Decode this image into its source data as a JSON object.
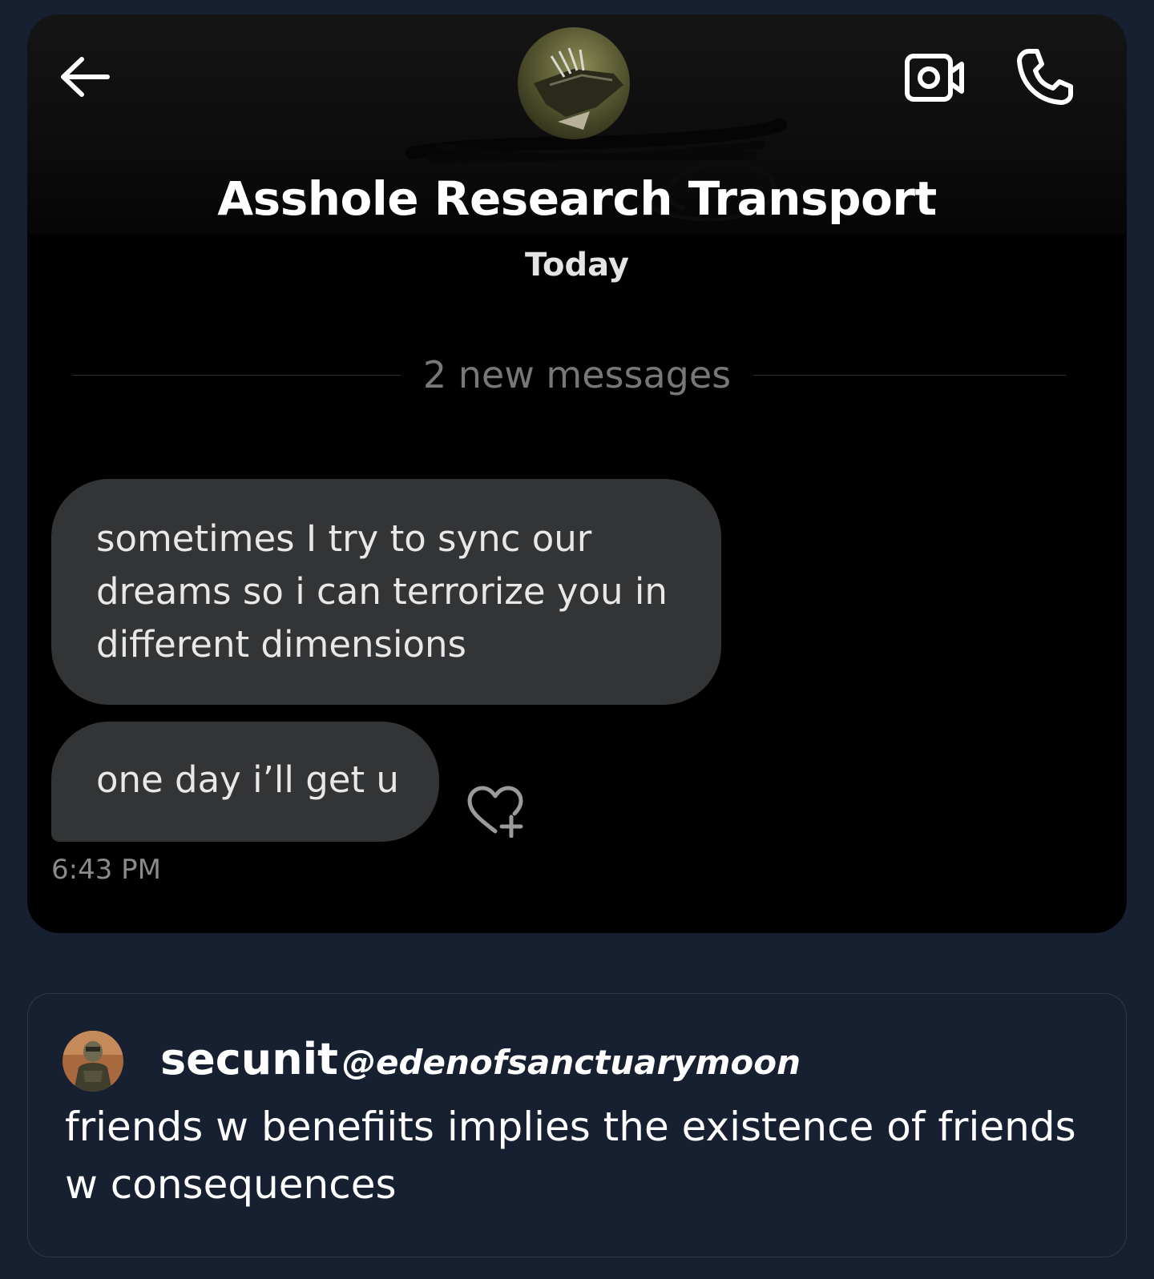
{
  "dm": {
    "contact_name": "Asshole Research Transport",
    "date_label": "Today",
    "new_messages_label": "2 new messages",
    "messages": [
      {
        "text": "sometimes I try to sync our dreams so i can terrorize you in different dimensions"
      },
      {
        "text": "one day i’ll get u"
      }
    ],
    "timestamp": "6:43 PM",
    "icons": {
      "back": "arrow-left-icon",
      "video": "video-camera-icon",
      "call": "phone-icon",
      "react": "heart-add-icon"
    }
  },
  "tweet": {
    "display_name": "secunit",
    "handle": "@edenofsanctuarymoon",
    "text": "friends w benefiits implies the existence of friends w consequences"
  },
  "colors": {
    "page_background": "#172030",
    "dm_background": "#000000",
    "bubble": "#333436",
    "tweet_border": "#2c3a4c"
  }
}
